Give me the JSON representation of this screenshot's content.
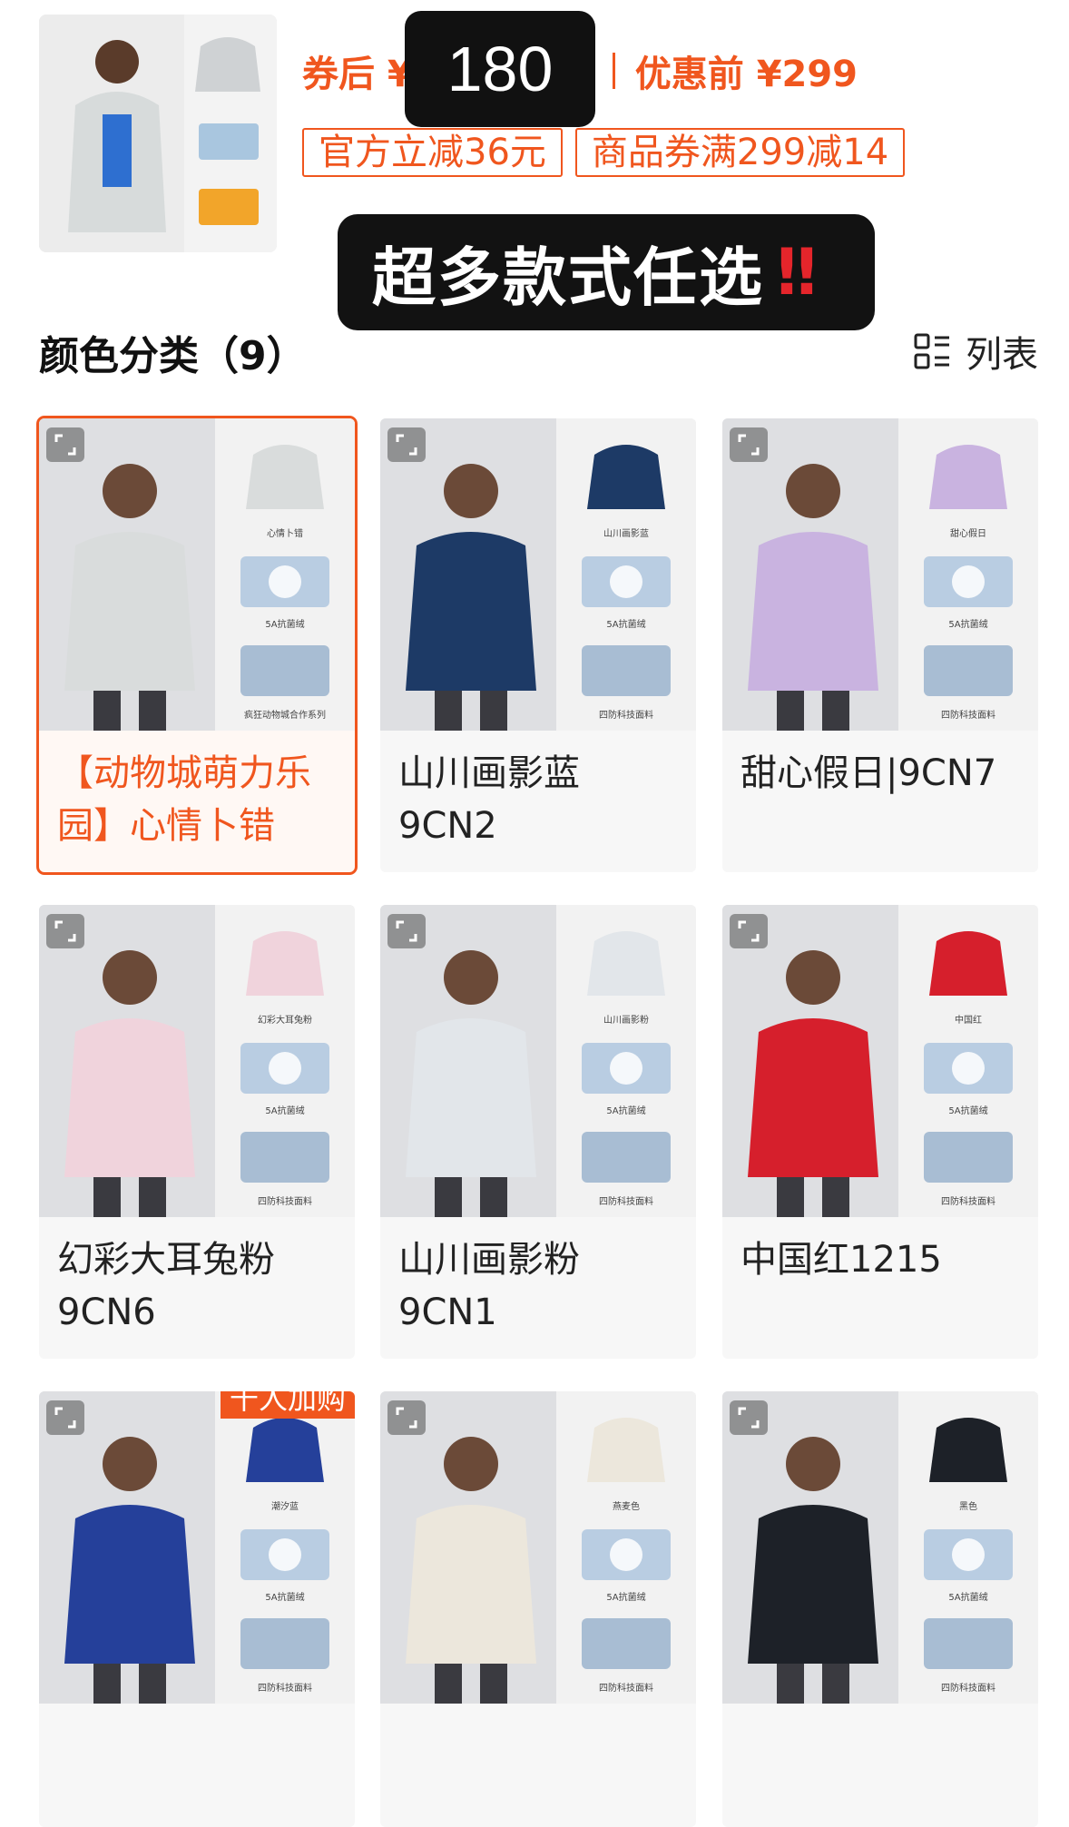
{
  "header": {
    "price_after": "券后 ¥",
    "price_before": "优惠前 ¥299",
    "price_overlay": "180",
    "coupons": [
      "官方立减36元",
      "商品券满299减14"
    ],
    "banner": "超多款式任选",
    "banner_mark": "‼"
  },
  "section": {
    "title": "颜色分类（9）",
    "view_label": "列表"
  },
  "items": [
    {
      "label": "【动物城萌力乐园】心情卜错",
      "side_labels": [
        "心情卜错",
        "5A抗菌绒",
        "疯狂动物城合作系列"
      ],
      "jacket": "#d9dcdc",
      "selected": true
    },
    {
      "label": "山川画影蓝 9CN2",
      "side_labels": [
        "山川画影蓝",
        "5A抗菌绒",
        "四防科技面料"
      ],
      "jacket": "#1d3a66"
    },
    {
      "label": "甜心假日|9CN7",
      "side_labels": [
        "甜心假日",
        "5A抗菌绒",
        "四防科技面料"
      ],
      "jacket": "#c9b3e0"
    },
    {
      "label": "幻彩大耳兔粉9CN6",
      "side_labels": [
        "幻彩大耳兔粉",
        "5A抗菌绒",
        "四防科技面料"
      ],
      "jacket": "#f0d3dc"
    },
    {
      "label": "山川画影粉 9CN1",
      "side_labels": [
        "山川画影粉",
        "5A抗菌绒",
        "四防科技面料"
      ],
      "jacket": "#e2e6ea"
    },
    {
      "label": "中国红1215",
      "side_labels": [
        "中国红",
        "5A抗菌绒",
        "四防科技面料"
      ],
      "jacket": "#d61f2c"
    },
    {
      "label": "",
      "side_labels": [
        "潮汐蓝",
        "5A抗菌绒",
        "四防科技面料"
      ],
      "jacket": "#25409a",
      "badge": "千人加购"
    },
    {
      "label": "",
      "side_labels": [
        "燕麦色",
        "5A抗菌绒",
        "四防科技面料"
      ],
      "jacket": "#ece7dc"
    },
    {
      "label": "",
      "side_labels": [
        "黑色",
        "5A抗菌绒",
        "四防科技面料"
      ],
      "jacket": "#1d2128"
    }
  ]
}
